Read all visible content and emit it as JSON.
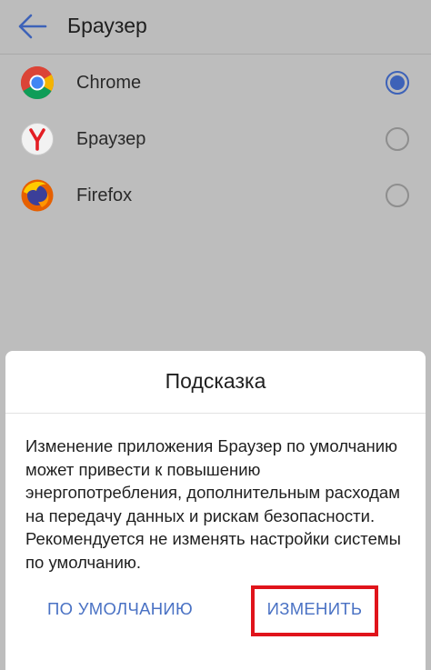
{
  "header": {
    "title": "Браузер"
  },
  "apps": [
    {
      "name": "Chrome",
      "icon": "chrome-icon",
      "selected": true
    },
    {
      "name": "Браузер",
      "icon": "yandex-browser-icon",
      "selected": false
    },
    {
      "name": "Firefox",
      "icon": "firefox-icon",
      "selected": false
    }
  ],
  "dialog": {
    "title": "Подсказка",
    "message": "Изменение приложения Браузер по умолчанию может привести к повышению энергопотребления, дополнительным расходам на передачу данных и рискам безопасности. Рекомендуется не изменять настройки системы по умолчанию.",
    "default_label": "ПО УМОЛЧАНИЮ",
    "change_label": "ИЗМЕНИТЬ"
  },
  "colors": {
    "accent": "#3d62b8",
    "button_text": "#4a72c4",
    "highlight": "#e0141b"
  }
}
